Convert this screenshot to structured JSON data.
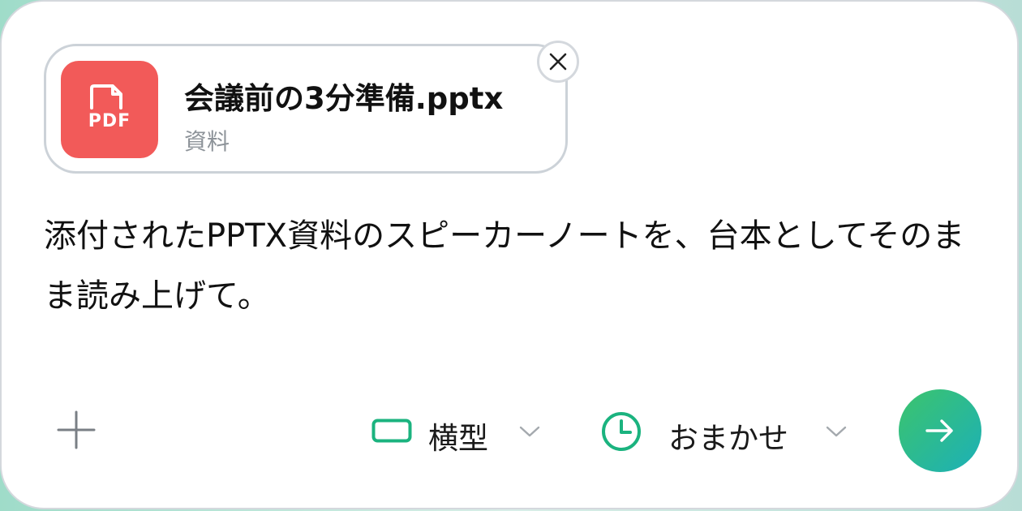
{
  "attachment": {
    "file_name": "会議前の3分準備.pptx",
    "file_kind": "資料",
    "tile_label": "PDF",
    "tile_color": "#f25a59",
    "tile_icon": "file-icon",
    "remove_icon": "close-icon"
  },
  "prompt": {
    "text": "添付されたPPTX資料のスピーカーノートを、台本としてそのまま読み上げて。"
  },
  "toolbar": {
    "add_icon": "plus-icon",
    "aspect": {
      "icon": "landscape-rectangle-icon",
      "label": "横型",
      "accent": "#1bb37f"
    },
    "duration": {
      "icon": "clock-icon",
      "label": "おまかせ",
      "accent": "#1bb37f"
    },
    "send_icon": "arrow-right-icon"
  }
}
